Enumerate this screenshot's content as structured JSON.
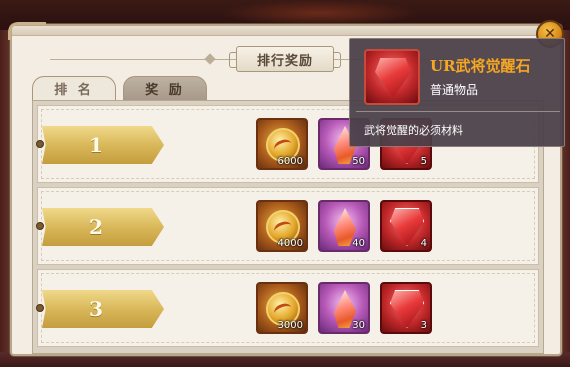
{
  "panel": {
    "title": "排行奖励",
    "close_label": "✕"
  },
  "tabs": [
    {
      "label": "排 名",
      "active": false
    },
    {
      "label": "奖 励",
      "active": true
    }
  ],
  "rows": [
    {
      "rank": "1",
      "rewards": [
        {
          "icon": "gold-coin-icon",
          "count": "6000"
        },
        {
          "icon": "pink-crystal-icon",
          "count": "50"
        },
        {
          "icon": "red-awakening-stone-icon",
          "count": "5"
        }
      ]
    },
    {
      "rank": "2",
      "rewards": [
        {
          "icon": "gold-coin-icon",
          "count": "4000"
        },
        {
          "icon": "pink-crystal-icon",
          "count": "40"
        },
        {
          "icon": "red-awakening-stone-icon",
          "count": "4"
        }
      ]
    },
    {
      "rank": "3",
      "rewards": [
        {
          "icon": "gold-coin-icon",
          "count": "3000"
        },
        {
          "icon": "pink-crystal-icon",
          "count": "30"
        },
        {
          "icon": "red-awakening-stone-icon",
          "count": "3"
        }
      ]
    }
  ],
  "tooltip": {
    "name": "UR武将觉醒石",
    "type": "普通物品",
    "description": "武将觉醒的必须材料",
    "name_color": "#f5a623"
  }
}
